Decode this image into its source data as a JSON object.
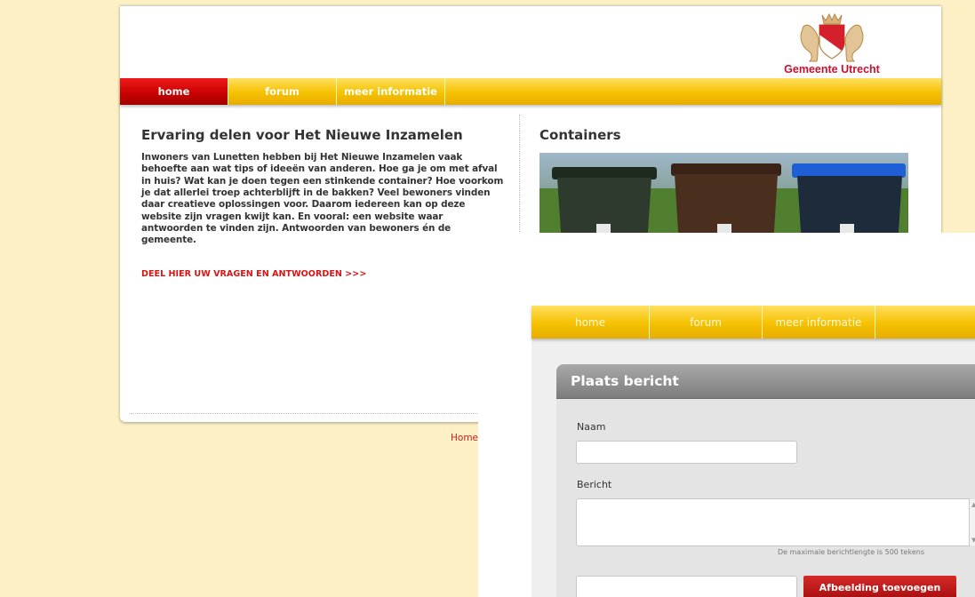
{
  "main": {
    "logo_text": "Gemeente Utrecht",
    "nav": [
      {
        "label": "home",
        "active": true
      },
      {
        "label": "forum",
        "active": false
      },
      {
        "label": "meer informatie",
        "active": false
      }
    ],
    "left": {
      "title": "Ervaring delen voor Het Nieuwe Inzamelen",
      "body": "Inwoners van Lunetten hebben bij Het Nieuwe Inzamelen vaak behoefte aan wat tips of ideeën van anderen. Hoe ga je om met afval in huis? Wat kan je doen tegen een stinkende container? Hoe voorkom je dat allerlei troep achterblijft in de bakken? Veel bewoners vinden daar creatieve oplossingen voor. Daarom iedereen kan op deze website zijn vragen kwijt kan. En vooral: een website waar antwoorden te vinden zijn. Antwoorden van bewoners én de gemeente.",
      "link": "DEEL HIER UW VRAGEN EN ANTWOORDEN >>>"
    },
    "right": {
      "title": "Containers"
    },
    "breadcrumb": "Home"
  },
  "overlay": {
    "nav": [
      {
        "label": "home"
      },
      {
        "label": "forum"
      },
      {
        "label": "meer informatie"
      }
    ],
    "panel_title": "Plaats bericht",
    "name_label": "Naam",
    "name_value": "",
    "message_label": "Bericht",
    "message_value": "",
    "hint": "De maximale berichtlengte is 500 tekens",
    "upload_button": "Afbeelding toevoegen"
  },
  "colors": {
    "page_bg": "#fcf0c4",
    "nav_yellow": "#f5c100",
    "nav_active_red": "#c50000",
    "link_red": "#d91515",
    "brand_red": "#c8102e",
    "bin_green": "#2e3a2e",
    "bin_brown": "#4a2e1e",
    "bin_blue": "#1f5fd6"
  },
  "icons": [
    "utrecht-coat-of-arms",
    "waste-container-photo"
  ]
}
